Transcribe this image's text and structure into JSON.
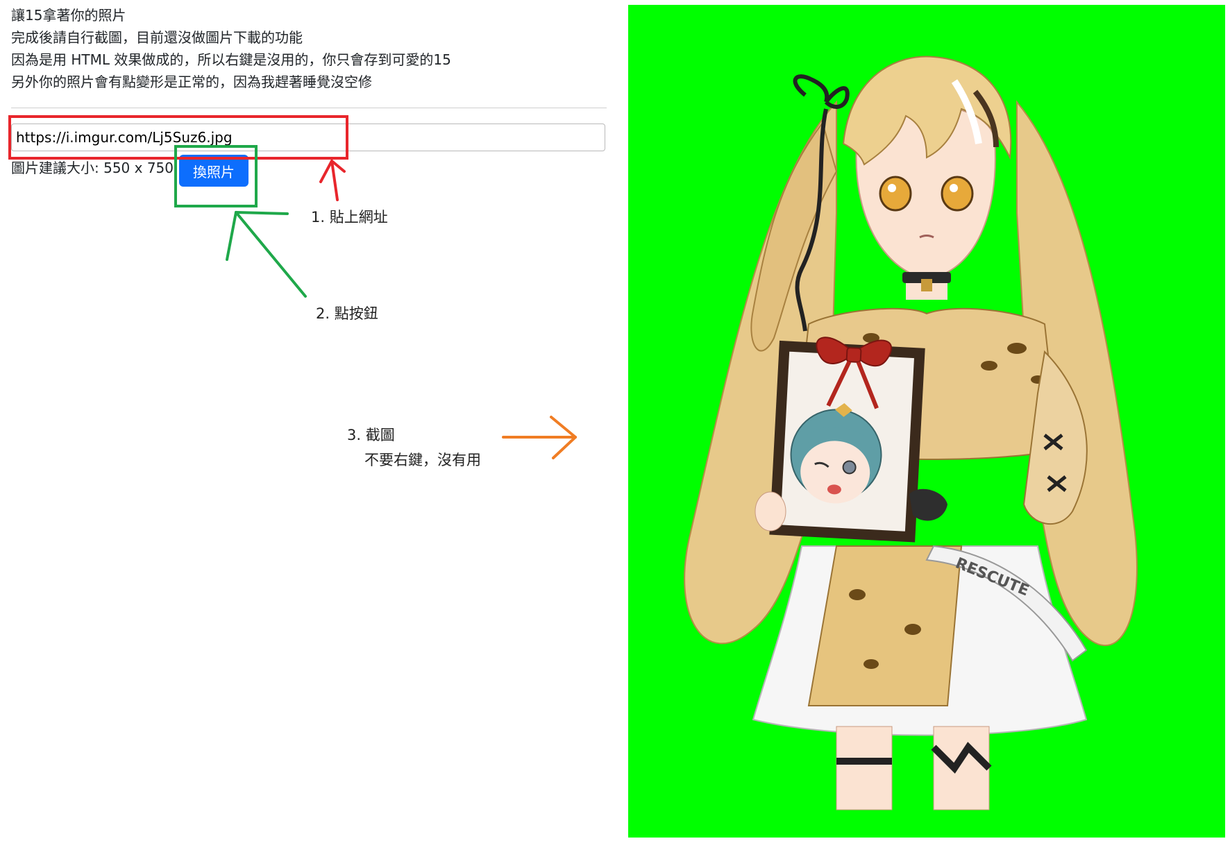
{
  "intro": {
    "line1": "讓15拿著你的照片",
    "line2": "完成後請自行截圖，目前還沒做圖片下載的功能",
    "line3": "因為是用 HTML 效果做成的，所以右鍵是沒用的，你只會存到可愛的15",
    "line4": "另外你的照片會有點變形是正常的，因為我趕著睡覺沒空修"
  },
  "form": {
    "url_value": "https://i.imgur.com/Lj5Suz6.jpg",
    "size_hint": "圖片建議大小: 550 x 750",
    "swap_button_label": "換照片"
  },
  "annotations": {
    "step1": "1. 貼上網址",
    "step2": "2. 點按鈕",
    "step3": "3. 截圖",
    "step3_note": "不要右鍵，沒有用"
  },
  "preview": {
    "background_color": "#00ff00",
    "frame_ribbon_text": "RESCUTE"
  },
  "colors": {
    "button_primary": "#0d6efd",
    "annotation_red": "#e8262c",
    "annotation_green": "#1fa84a",
    "annotation_orange": "#f07d24"
  }
}
